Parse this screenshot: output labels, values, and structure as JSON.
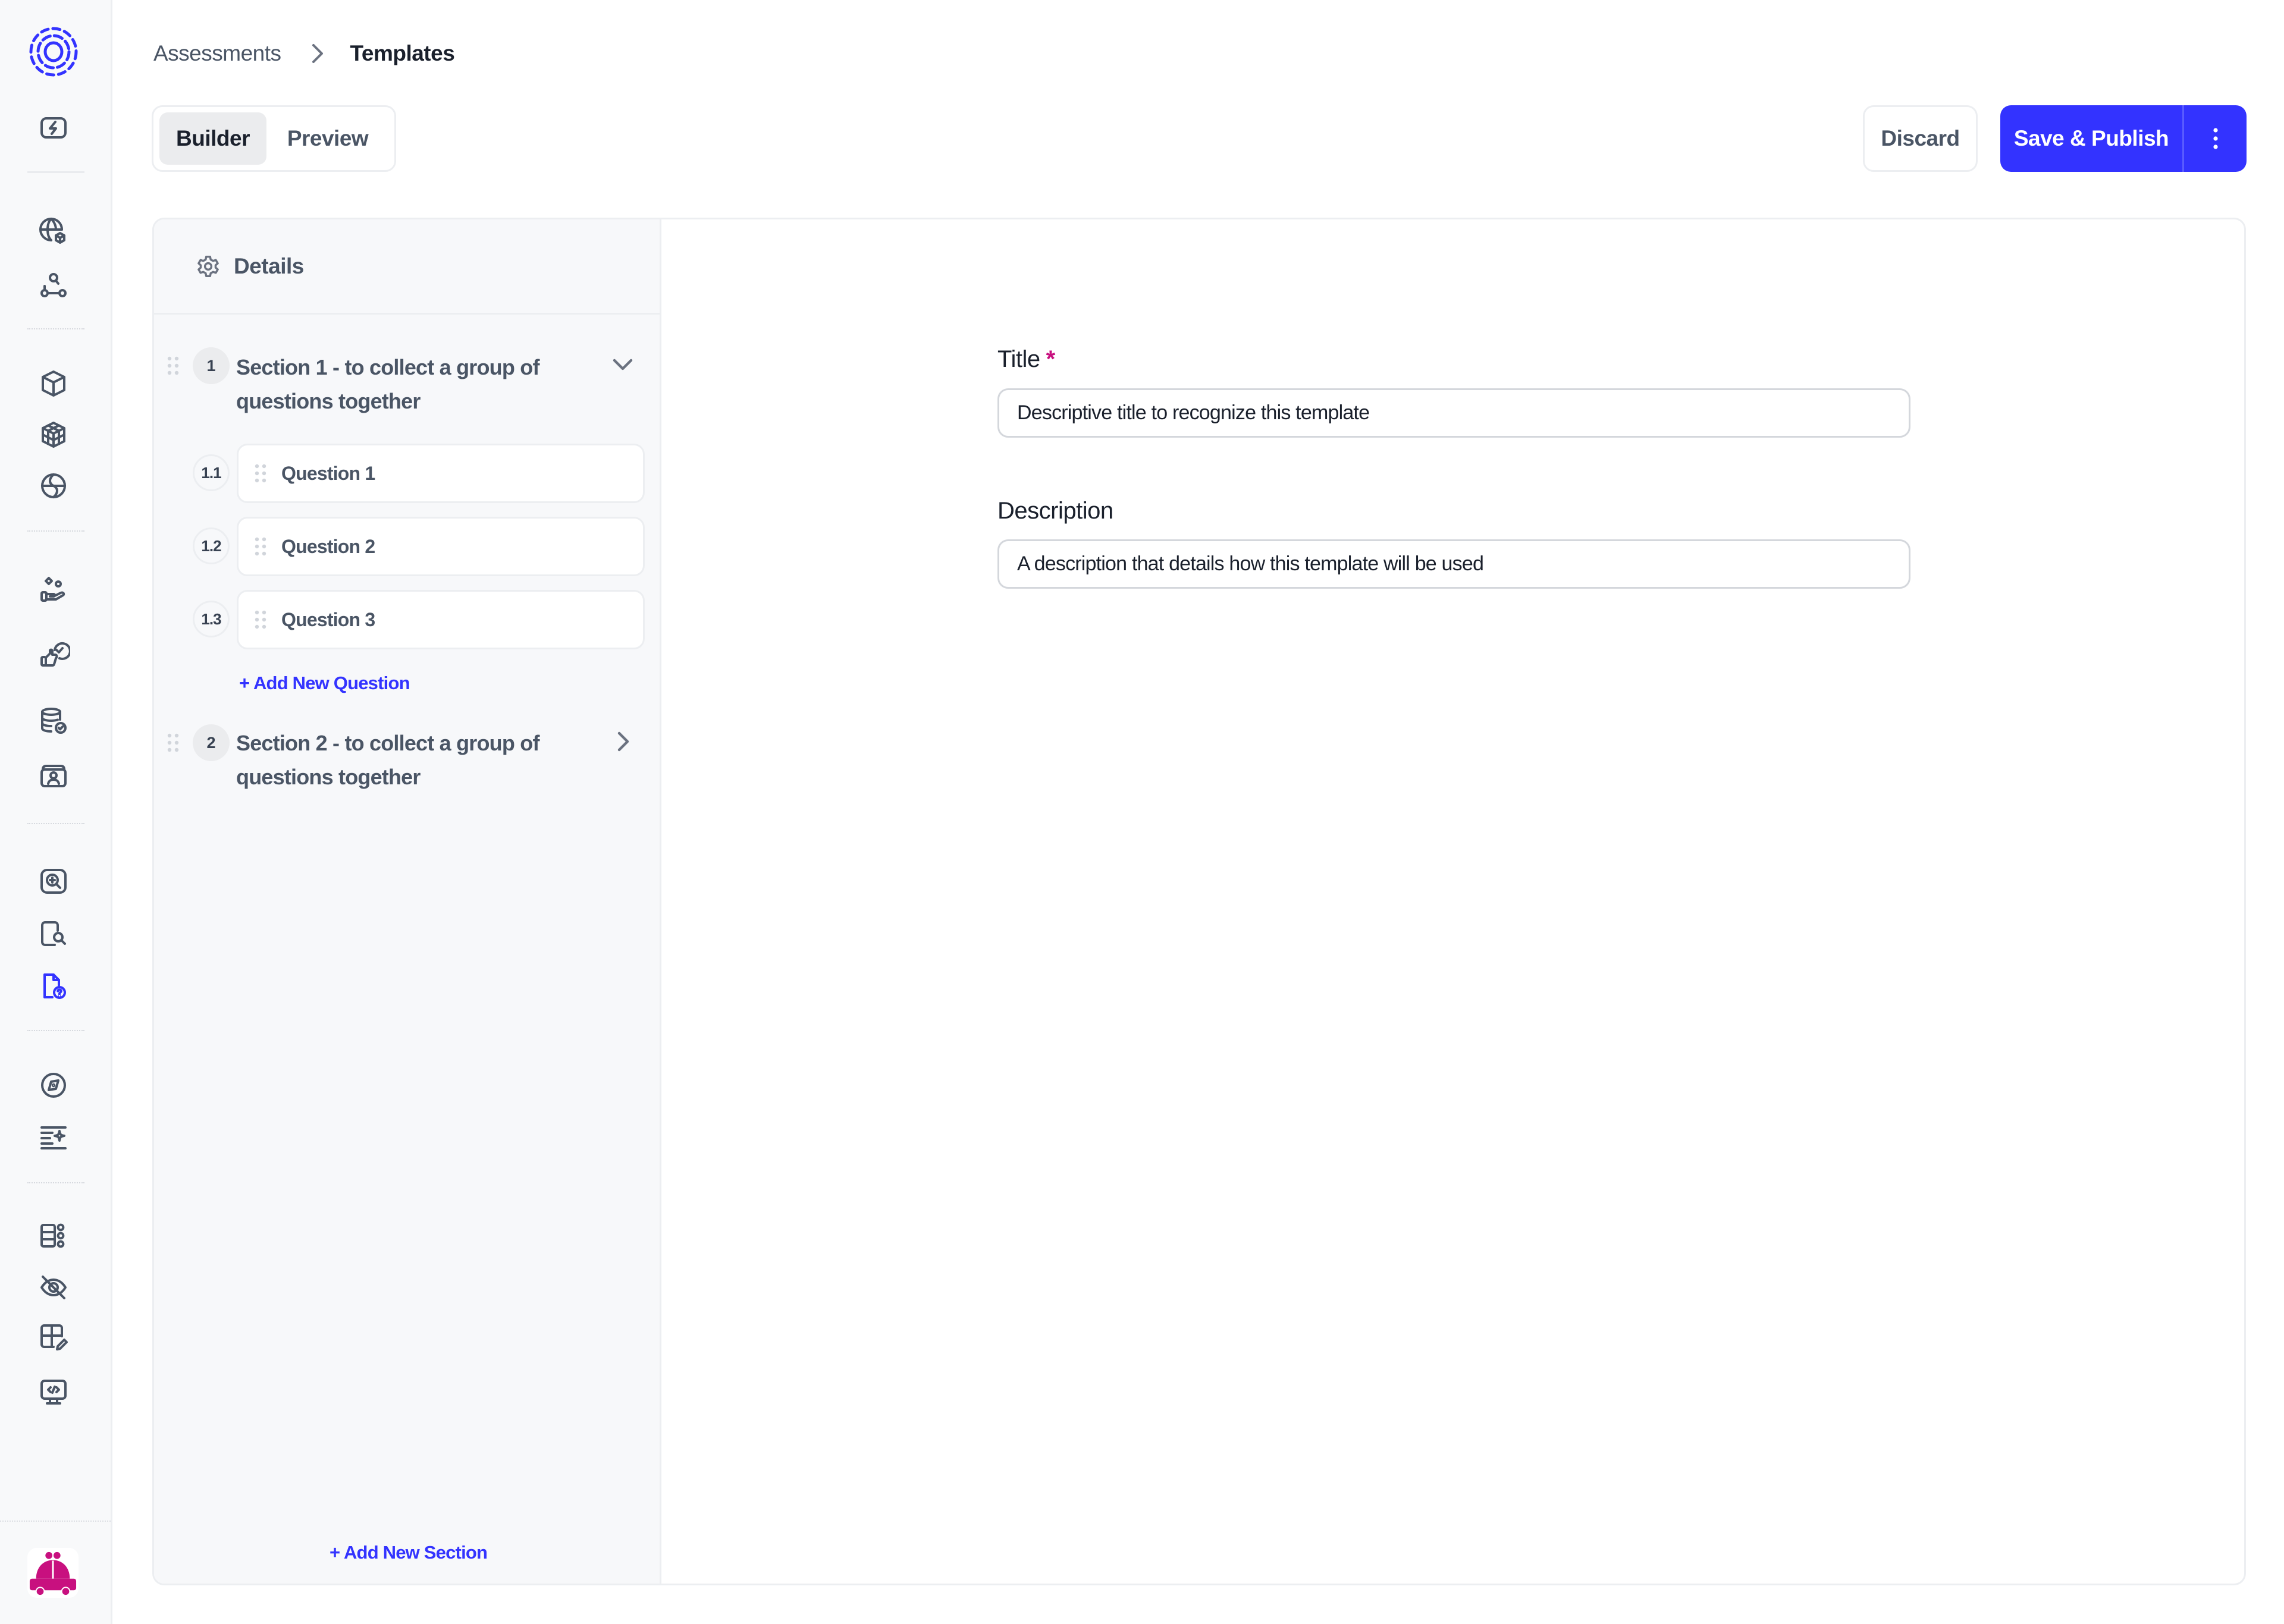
{
  "sidebar": {
    "logo": "brand-logo-dashed-rings",
    "items": [
      {
        "icon": "lightning-icon",
        "active": false
      },
      {
        "icon": "globe-box-icon",
        "active": false
      },
      {
        "icon": "nodes-icon",
        "active": false
      },
      {
        "icon": "cube-icon",
        "active": false
      },
      {
        "icon": "cubes-icon",
        "active": false
      },
      {
        "icon": "globe-orbit-icon",
        "active": false
      },
      {
        "icon": "hand-shapes-icon",
        "active": false
      },
      {
        "icon": "thumbs-up-check-icon",
        "active": false
      },
      {
        "icon": "database-check-icon",
        "active": false
      },
      {
        "icon": "folder-user-icon",
        "active": false
      },
      {
        "icon": "zoom-in-box-icon",
        "active": false
      },
      {
        "icon": "document-search-icon",
        "active": false
      },
      {
        "icon": "document-question-icon",
        "active": true
      },
      {
        "icon": "compass-icon",
        "active": false
      },
      {
        "icon": "text-sparkle-icon",
        "active": false
      },
      {
        "icon": "grid-nodes-icon",
        "active": false
      },
      {
        "icon": "eye-off-icon",
        "active": false
      },
      {
        "icon": "grid-pencil-icon",
        "active": false
      },
      {
        "icon": "monitor-code-icon",
        "active": false
      }
    ],
    "avatar": "car-avatar"
  },
  "breadcrumb": {
    "parent": "Assessments",
    "current": "Templates"
  },
  "view_toggle": {
    "options": [
      "Builder",
      "Preview"
    ],
    "selected": "Builder"
  },
  "actions": {
    "discard": "Discard",
    "save_publish": "Save & Publish",
    "more": "more-vertical-icon"
  },
  "builder": {
    "details_label": "Details",
    "sections": [
      {
        "number": "1",
        "title": "Section 1 - to collect a group of questions together",
        "expanded": true,
        "questions": [
          {
            "number": "1.1",
            "label": "Question 1"
          },
          {
            "number": "1.2",
            "label": "Question 2"
          },
          {
            "number": "1.3",
            "label": "Question 3"
          }
        ],
        "add_question_label": "+ Add New Question"
      },
      {
        "number": "2",
        "title": "Section 2 - to collect a group of questions together",
        "expanded": false,
        "questions": []
      }
    ],
    "add_section_label": "+ Add New Section"
  },
  "form": {
    "title_label": "Title",
    "title_required_mark": "*",
    "title_value": "Descriptive title to recognize this template",
    "description_label": "Description",
    "description_value": "A description that details how this template will be used"
  },
  "colors": {
    "accent": "#3333ff",
    "required": "#c8107f",
    "avatar": "#c8107f"
  }
}
